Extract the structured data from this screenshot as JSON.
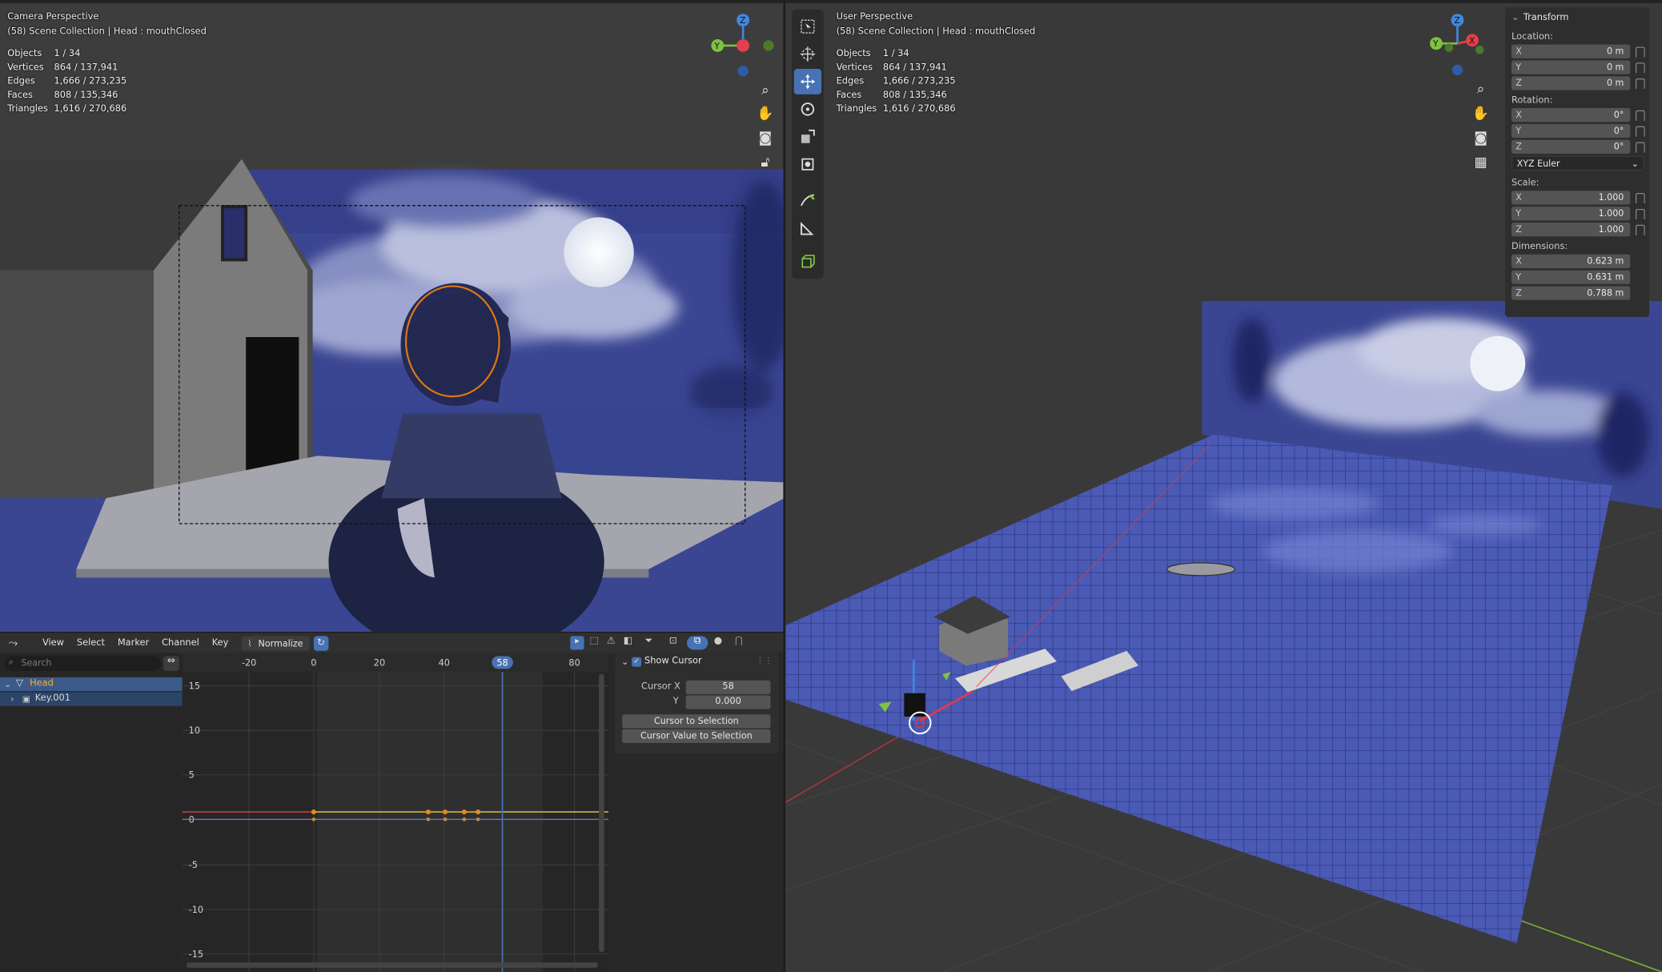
{
  "camera_view": {
    "title": "Camera Perspective",
    "collection": "(58) Scene Collection | Head : mouthClosed",
    "stats": [
      {
        "label": "Objects",
        "value": "1 / 34"
      },
      {
        "label": "Vertices",
        "value": "864 / 137,941"
      },
      {
        "label": "Edges",
        "value": "1,666 / 273,235"
      },
      {
        "label": "Faces",
        "value": "808 / 135,346"
      },
      {
        "label": "Triangles",
        "value": "1,616 / 270,686"
      }
    ],
    "gizmo": {
      "z": "Z",
      "y": "Y"
    }
  },
  "user_view": {
    "title": "User Perspective",
    "collection": "(58) Scene Collection | Head : mouthClosed",
    "stats": [
      {
        "label": "Objects",
        "value": "1 / 34"
      },
      {
        "label": "Vertices",
        "value": "864 / 137,941"
      },
      {
        "label": "Edges",
        "value": "1,666 / 273,235"
      },
      {
        "label": "Faces",
        "value": "808 / 135,346"
      },
      {
        "label": "Triangles",
        "value": "1,616 / 270,686"
      }
    ],
    "gizmo": {
      "z": "Z",
      "y": "Y",
      "x": "X"
    }
  },
  "transform": {
    "title": "Transform",
    "location_label": "Location:",
    "location": [
      {
        "axis": "X",
        "value": "0 m"
      },
      {
        "axis": "Y",
        "value": "0 m"
      },
      {
        "axis": "Z",
        "value": "0 m"
      }
    ],
    "rotation_label": "Rotation:",
    "rotation": [
      {
        "axis": "X",
        "value": "0°"
      },
      {
        "axis": "Y",
        "value": "0°"
      },
      {
        "axis": "Z",
        "value": "0°"
      }
    ],
    "rotation_mode": "XYZ Euler",
    "scale_label": "Scale:",
    "scale": [
      {
        "axis": "X",
        "value": "1.000"
      },
      {
        "axis": "Y",
        "value": "1.000"
      },
      {
        "axis": "Z",
        "value": "1.000"
      }
    ],
    "dimensions_label": "Dimensions:",
    "dimensions": [
      {
        "axis": "X",
        "value": "0.623 m"
      },
      {
        "axis": "Y",
        "value": "0.631 m"
      },
      {
        "axis": "Z",
        "value": "0.788 m"
      }
    ]
  },
  "graph_editor": {
    "menu": [
      "View",
      "Select",
      "Marker",
      "Channel",
      "Key"
    ],
    "normalize": "Normalize",
    "search_placeholder": "Search",
    "channels": [
      {
        "label": "Head"
      },
      {
        "label": "Key.001"
      }
    ],
    "x_ticks": [
      "-20",
      "0",
      "20",
      "40",
      "80"
    ],
    "current_frame": "58",
    "y_ticks": [
      "15",
      "10",
      "5",
      "0",
      "-5",
      "-10",
      "-15"
    ],
    "panel": {
      "show_cursor": "Show Cursor",
      "cursor_x_label": "Cursor X",
      "cursor_x": "58",
      "cursor_y_label": "Y",
      "cursor_y": "0.000",
      "btn_cursor_to_selection": "Cursor to Selection",
      "btn_cursor_value": "Cursor Value to Selection"
    }
  },
  "colors": {
    "accent": "#4772b3",
    "water": "#4a5ab5",
    "sky": "#3b4693",
    "axis_x": "#e0414a",
    "axis_y": "#7ec240",
    "axis_z": "#3f88e0",
    "curve_orange": "#e38a22",
    "curve_yellow": "#d9c840"
  }
}
